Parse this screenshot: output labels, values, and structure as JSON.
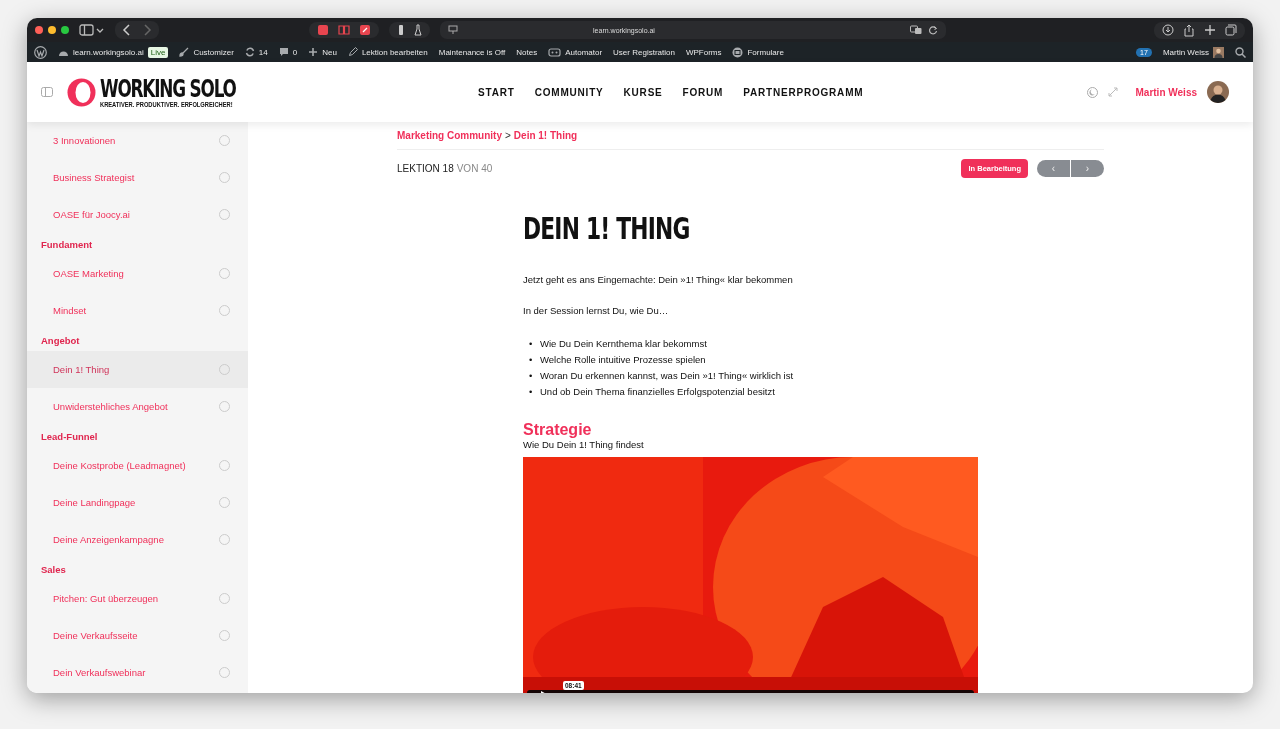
{
  "browser": {
    "url": "learn.workingsolo.ai"
  },
  "admin_bar": {
    "items": [
      {
        "kind": "wp"
      },
      {
        "kind": "site",
        "label": "learn.workingsolo.ai"
      },
      {
        "kind": "live",
        "label": "Live"
      },
      {
        "kind": "customizer",
        "label": "Customizer"
      },
      {
        "kind": "updates",
        "label": "14"
      },
      {
        "kind": "comments",
        "label": "0"
      },
      {
        "kind": "new",
        "label": "Neu"
      },
      {
        "kind": "edit",
        "label": "Lektion bearbeiten"
      },
      {
        "kind": "text",
        "label": "Maintenance is Off"
      },
      {
        "kind": "text",
        "label": "Notes"
      },
      {
        "kind": "automator",
        "label": "Automator"
      },
      {
        "kind": "text",
        "label": "User Registration"
      },
      {
        "kind": "text",
        "label": "WPForms"
      },
      {
        "kind": "forms",
        "label": "Formulare"
      }
    ],
    "notifications": "17",
    "user": "Martin Weiss"
  },
  "logo": {
    "name": "WORKING SOLO",
    "tagline": "KREATIVER. PRODUKTIVER. ERFOLGREICHER!"
  },
  "nav": [
    "START",
    "COMMUNITY",
    "KURSE",
    "FORUM",
    "PARTNERPROGRAMM"
  ],
  "user": {
    "name": "Martin Weiss"
  },
  "sidebar": {
    "items": [
      {
        "kind": "lesson",
        "label": "3 Innovationen",
        "selected": false
      },
      {
        "kind": "lesson",
        "label": "Business Strategist",
        "selected": false
      },
      {
        "kind": "lesson",
        "label": "OASE für Joocy.ai",
        "selected": false
      },
      {
        "kind": "section",
        "label": "Fundament"
      },
      {
        "kind": "lesson",
        "label": "OASE Marketing",
        "selected": false
      },
      {
        "kind": "lesson",
        "label": "Mindset",
        "selected": false
      },
      {
        "kind": "section",
        "label": "Angebot"
      },
      {
        "kind": "lesson",
        "label": "Dein 1! Thing",
        "selected": true
      },
      {
        "kind": "lesson",
        "label": "Unwiderstehliches Angebot",
        "selected": false
      },
      {
        "kind": "section",
        "label": "Lead-Funnel"
      },
      {
        "kind": "lesson",
        "label": "Deine Kostprobe (Leadmagnet)",
        "selected": false
      },
      {
        "kind": "lesson",
        "label": "Deine Landingpage",
        "selected": false
      },
      {
        "kind": "lesson",
        "label": "Deine Anzeigenkampagne",
        "selected": false
      },
      {
        "kind": "section",
        "label": "Sales"
      },
      {
        "kind": "lesson",
        "label": "Pitchen: Gut überzeugen",
        "selected": false
      },
      {
        "kind": "lesson",
        "label": "Deine Verkaufsseite",
        "selected": false
      },
      {
        "kind": "lesson",
        "label": "Dein Verkaufswebinar",
        "selected": false
      }
    ]
  },
  "breadcrumb": {
    "parent": "Marketing Community",
    "separator": ">",
    "current": "Dein 1! Thing"
  },
  "lesson_counter": {
    "lesson": "LEKTION 18",
    "of": "VON 40"
  },
  "status_button": "In Bearbeitung",
  "pager": {
    "previous": "‹",
    "next": "›"
  },
  "article": {
    "title": "DEIN 1! THING",
    "intro": "Jetzt geht es ans Eingemachte: Dein »1! Thing« klar bekommen",
    "lead": "In der Session lernst Du, wie Du…",
    "bullet_marker": "•",
    "bullets": [
      "Wie Du Dein Kernthema klar bekommst",
      "Welche Rolle intuitive Prozesse spielen",
      "Woran Du erkennen kannst, was Dein »1! Thing« wirklich ist",
      "Und ob Dein Thema finanzielles Erfolgspotenzial besitzt"
    ],
    "heading": "Strategie",
    "subheading": "Wie Du Dein 1! Thing findest",
    "video": {
      "kind": "picture",
      "time_tooltip": "08:41"
    }
  }
}
